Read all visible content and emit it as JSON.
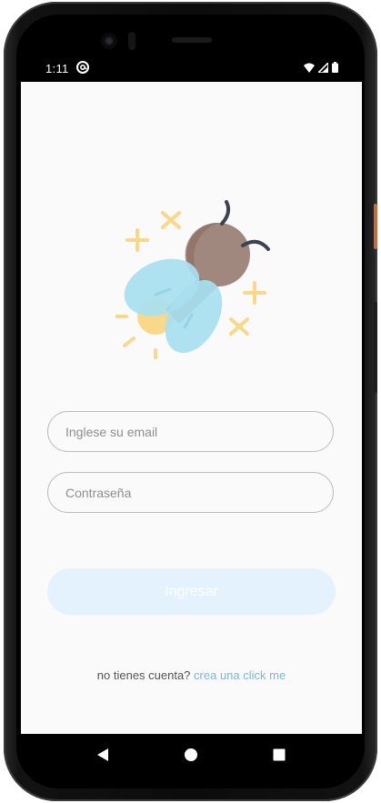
{
  "status_bar": {
    "time": "1:11",
    "app_icon": "at-sign-icon",
    "wifi_icon": "wifi-icon",
    "signal_icon": "signal-icon",
    "battery_icon": "battery-icon"
  },
  "logo": {
    "icon": "firefly-icon"
  },
  "login_form": {
    "email_placeholder": "Inglese su email",
    "password_placeholder": "Contraseña",
    "submit_label": "Ingresar"
  },
  "signup": {
    "prompt": "no tienes cuenta?",
    "link": "crea una click me"
  },
  "nav_bar": {
    "back_icon": "back-triangle-icon",
    "home_icon": "home-circle-icon",
    "recents_icon": "recents-square-icon"
  },
  "colors": {
    "button_bg": "#e3f2fd",
    "link": "#81b4d6",
    "field_border": "#bdbdbd",
    "app_bg": "#fafafa"
  }
}
